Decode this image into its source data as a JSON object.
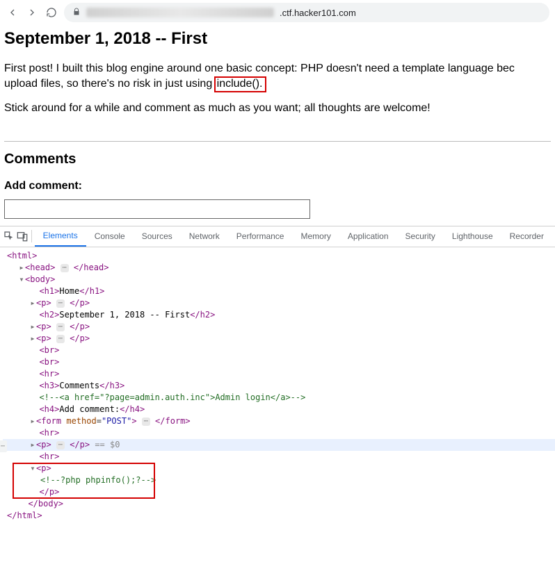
{
  "browser": {
    "url_suffix": ".ctf.hacker101.com"
  },
  "post": {
    "title": "September 1, 2018 -- First",
    "para1_a": "First post! I built this blog engine around one basic concept: PHP doesn't need a template language bec",
    "para1_b": "upload files, so there's no risk in just using",
    "include_text": "include().",
    "para2": "Stick around for a while and comment as much as you want; all thoughts are welcome!",
    "comments_heading": "Comments",
    "add_comment_heading": "Add comment:"
  },
  "devtools": {
    "tabs": [
      "Elements",
      "Console",
      "Sources",
      "Network",
      "Performance",
      "Memory",
      "Application",
      "Security",
      "Lighthouse",
      "Recorder"
    ],
    "active_tab": "Elements"
  },
  "dom": {
    "html_open": "<html>",
    "head": {
      "open": "<head>",
      "close": "</head>"
    },
    "body_open": "<body>",
    "h1": {
      "open": "<h1>",
      "text": "Home",
      "close": "</h1>"
    },
    "p_generic": {
      "open": "<p>",
      "close": "</p>"
    },
    "h2": {
      "open": "<h2>",
      "text": "September 1, 2018 -- First",
      "close": "</h2>"
    },
    "br": "<br>",
    "hr": "<hr>",
    "h3": {
      "open": "<h3>",
      "text": "Comments",
      "close": "</h3>"
    },
    "admin_comment": "<!--<a href=\"?page=admin.auth.inc\">Admin login</a>-->",
    "h4": {
      "open": "<h4>",
      "text": "Add comment:",
      "close": "</h4>"
    },
    "form": {
      "open_a": "<form ",
      "attr_name": "method",
      "attr_val": "\"POST\"",
      "open_b": ">",
      "close": "</form>"
    },
    "eq0": " == $0",
    "p_open_only": "<p>",
    "php_comment": "<!--?php phpinfo();?-->",
    "p_close_only": "</p>",
    "body_close": "</body>",
    "html_close": "</html>"
  }
}
